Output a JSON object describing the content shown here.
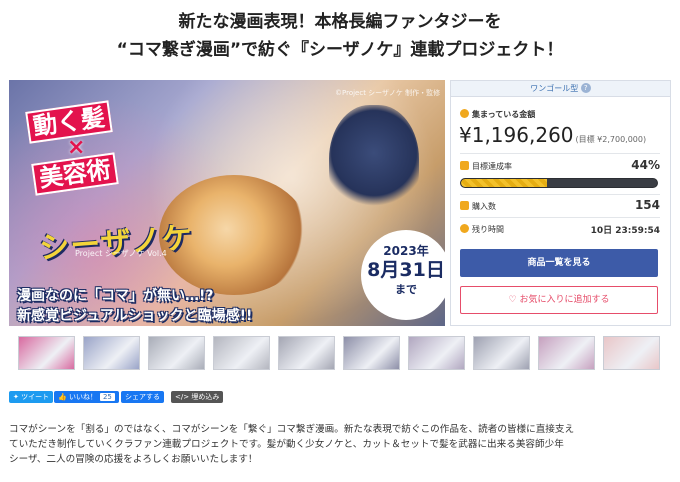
{
  "page": {
    "title_line1": "新たな漫画表現！本格長編ファンタジーを",
    "title_line2": "“コマ繋ぎ漫画”で紡ぐ『シーザノケ』連載プロジェクト！"
  },
  "hero": {
    "badge_top": "動く髪",
    "badge_x": "×",
    "badge_bottom": "美容術",
    "logo": "シーザノケ",
    "project_label": "Project シーザノケ Vol.4",
    "date_year": "2023年",
    "date_day": "8月31日",
    "date_until": "まで",
    "caption_line1": "漫画なのに「コマ」が無い…!?",
    "caption_line2": "新感覚ビジュアルショックと臨場感!!",
    "credit": "©Project シーザノケ 制作・監修"
  },
  "panel": {
    "type_label": "ワンゴール型",
    "help": "?",
    "funds_label": "集まっている金額",
    "funds_value": "¥1,196,260",
    "goal_text": "(目標 ¥2,700,000)",
    "rate_label": "目標達成率",
    "rate_value": "44%",
    "progress_percent": 44,
    "buyers_label": "購入数",
    "buyers_value": "154",
    "remaining_label": "残り時間",
    "remaining_value": "10日 23:59:54",
    "primary_button": "商品一覧を見る",
    "fav_button": "お気に入りに追加する",
    "heart": "♡"
  },
  "thumbnails": [
    {
      "name": "thumb-1",
      "color": "#d86aa0"
    },
    {
      "name": "thumb-2",
      "color": "#9aa4c8"
    },
    {
      "name": "thumb-3",
      "color": "#a9adb8"
    },
    {
      "name": "thumb-4",
      "color": "#b4b6bf"
    },
    {
      "name": "thumb-5",
      "color": "#a4a6b3"
    },
    {
      "name": "thumb-6",
      "color": "#8d8fa8"
    },
    {
      "name": "thumb-7",
      "color": "#b1a7c0"
    },
    {
      "name": "thumb-8",
      "color": "#9ea1b1"
    },
    {
      "name": "thumb-9",
      "color": "#c6a1bf"
    },
    {
      "name": "thumb-10",
      "color": "#e9c6c8"
    }
  ],
  "share": {
    "tweet": "ツイート",
    "like": "いいね！",
    "like_count": "25",
    "share": "シェアする",
    "embed": "埋め込み",
    "colors": {
      "twitter": "#1d9bf0",
      "facebook": "#1877f2",
      "share": "#1877f2",
      "embed": "#555555"
    }
  },
  "description": {
    "line1": "コマがシーンを「割る」のではなく、コマがシーンを「繋ぐ」コマ繋ぎ漫画。新たな表現で紡ぐこの作品を、読者の皆様に直接支え",
    "line2": "ていただき制作していくクラファン連載プロジェクトです。髪が動く少女ノケと、カット＆セットで髪を武器に出来る美容師少年",
    "line3": "シーザ、二人の冒険の応援をよろしくお願いいたします！"
  }
}
